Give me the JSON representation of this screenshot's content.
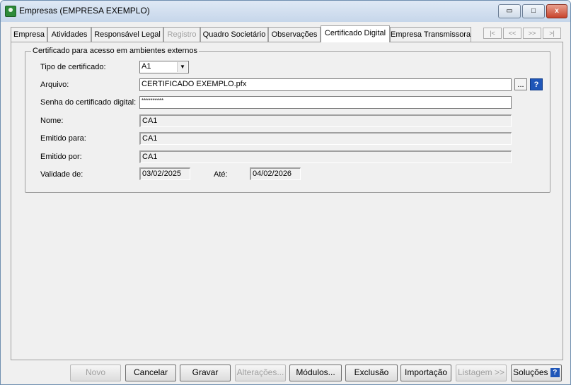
{
  "window": {
    "title": "Empresas (EMPRESA EXEMPLO)",
    "min": "▭",
    "max": "□",
    "close": "x"
  },
  "tabs": [
    {
      "label": "Empresa",
      "state": "normal"
    },
    {
      "label": "Atividades",
      "state": "normal"
    },
    {
      "label": "Responsável Legal",
      "state": "normal"
    },
    {
      "label": "Registro",
      "state": "disabled"
    },
    {
      "label": "Quadro Societário",
      "state": "normal"
    },
    {
      "label": "Observações",
      "state": "normal"
    },
    {
      "label": "Certificado Digital",
      "state": "active"
    },
    {
      "label": "Empresa Transmissora",
      "state": "normal"
    }
  ],
  "nav": {
    "first": "|<",
    "prev": "<<",
    "next": ">>",
    "last": ">|"
  },
  "group": {
    "title": "Certificado para acesso em ambientes externos",
    "tipo_label": "Tipo de certificado:",
    "tipo_value": "A1",
    "arquivo_label": "Arquivo:",
    "arquivo_value": "CERTIFICADO EXEMPLO.pfx",
    "browse": "...",
    "help": "?",
    "senha_label": "Senha do certificado digital:",
    "senha_value": "**********",
    "nome_label": "Nome:",
    "nome_value": "CA1",
    "emitido_para_label": "Emitido para:",
    "emitido_para_value": "CA1",
    "emitido_por_label": "Emitido por:",
    "emitido_por_value": "CA1",
    "validade_label": "Validade de:",
    "validade_de": "03/02/2025",
    "ate_label": "Até:",
    "validade_ate": "04/02/2026"
  },
  "buttons": {
    "novo": "Novo",
    "cancelar": "Cancelar",
    "gravar": "Gravar",
    "alteracoes": "Alterações...",
    "modulos": "Módulos...",
    "exclusao": "Exclusão",
    "importacao": "Importação",
    "listagem": "Listagem >>",
    "solucoes": "Soluções",
    "solucoes_help": "?"
  }
}
